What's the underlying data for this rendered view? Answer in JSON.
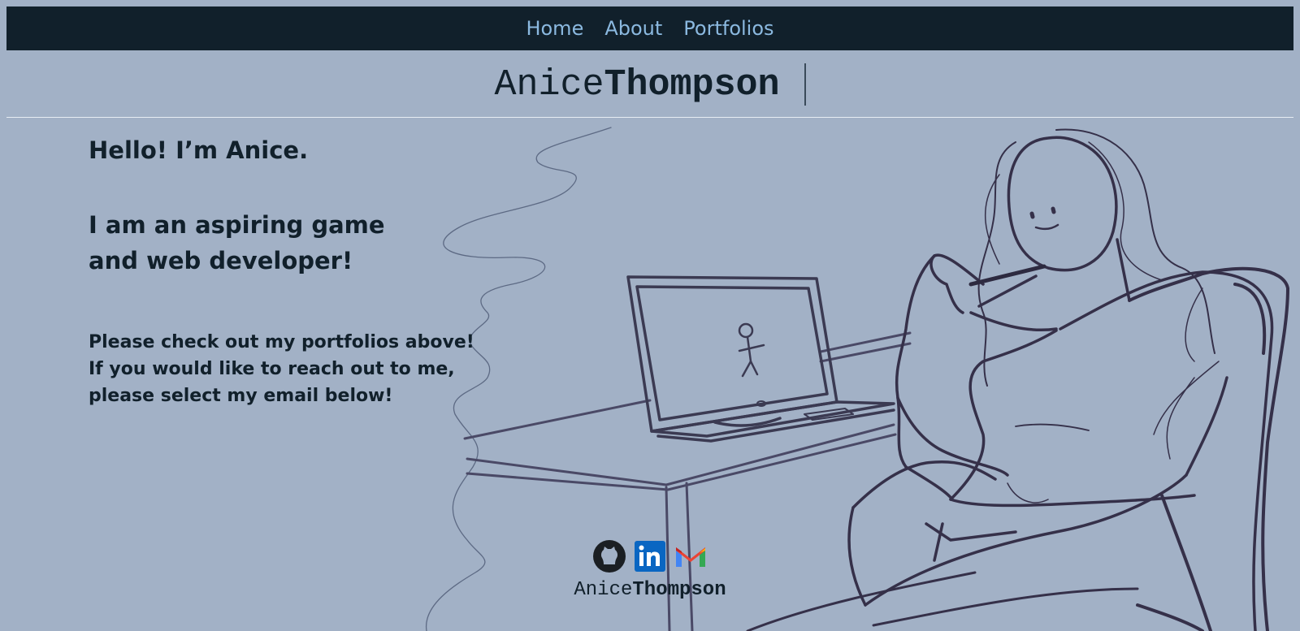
{
  "nav": {
    "items": [
      {
        "label": "Home"
      },
      {
        "label": "About"
      },
      {
        "label": "Portfolios"
      }
    ]
  },
  "header": {
    "brand_light": "Anice",
    "brand_bold": "Thompson"
  },
  "intro": {
    "greeting": "Hello! I’m Anice.",
    "tagline_line1": "I am an aspiring game",
    "tagline_line2": "and web developer!",
    "message_line1": "Please check out my portfolios above!",
    "message_line2": "If you would like to reach out to me,",
    "message_line3": "please select my email below!"
  },
  "footer": {
    "social_icons": [
      "github-icon",
      "linkedin-icon",
      "gmail-icon"
    ],
    "brand_light": "Anice",
    "brand_bold": "Thompson"
  },
  "colors": {
    "background": "#a2b1c6",
    "navbar": "#11202b",
    "nav_link": "#8bb9e0",
    "text": "#11202b",
    "sketch": "#3b3a52"
  }
}
